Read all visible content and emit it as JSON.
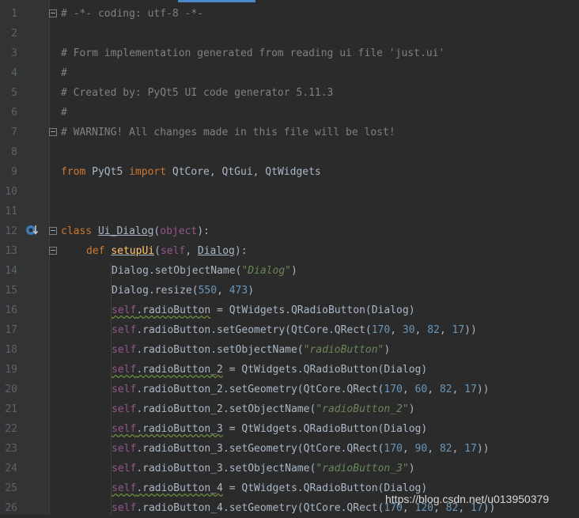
{
  "lines": [
    {
      "n": "1"
    },
    {
      "n": "2"
    },
    {
      "n": "3"
    },
    {
      "n": "4"
    },
    {
      "n": "5"
    },
    {
      "n": "6"
    },
    {
      "n": "7"
    },
    {
      "n": "8"
    },
    {
      "n": "9"
    },
    {
      "n": "10"
    },
    {
      "n": "11"
    },
    {
      "n": "12"
    },
    {
      "n": "13"
    },
    {
      "n": "14"
    },
    {
      "n": "15"
    },
    {
      "n": "16"
    },
    {
      "n": "17"
    },
    {
      "n": "18"
    },
    {
      "n": "19"
    },
    {
      "n": "20"
    },
    {
      "n": "21"
    },
    {
      "n": "22"
    },
    {
      "n": "23"
    },
    {
      "n": "24"
    },
    {
      "n": "25"
    },
    {
      "n": "26"
    }
  ],
  "code": {
    "l1": "# -*- coding: utf-8 -*-",
    "l3": "# Form implementation generated from reading ui file 'just.ui'",
    "l4": "#",
    "l5": "# Created by: PyQt5 UI code generator 5.11.3",
    "l6": "#",
    "l7": "# WARNING! All changes made in this file will be lost!",
    "kw_from": "from",
    "mod_pyqt5": " PyQt5 ",
    "kw_import": "import",
    "imports": " QtCore, QtGui, QtWidgets",
    "kw_class": "class",
    "cls_name": "Ui_Dialog",
    "kw_object": "object",
    "kw_def": "def",
    "fn_setupui": "setupUi",
    "kw_self": "self",
    "arg_dialog": "Dialog",
    "dialog": "Dialog",
    "set_object_name": ".setObjectName(",
    "str_dialog": "\"Dialog\"",
    "resize": ".resize(",
    "num_550": "550",
    "num_473": "473",
    "rb1_attr": ".radioButton",
    "rb2_attr": ".radioButton_2",
    "rb3_attr": ".radioButton_3",
    "rb4_attr": ".radioButton_4",
    "rb1_create": " = QtWidgets.QRadioButton(Dialog)",
    "set_geometry": ".setGeometry(QtCore.QRect(",
    "set_obj": ".setObjectName(",
    "str_rb1": "\"radioButton\"",
    "str_rb2": "\"radioButton_2\"",
    "str_rb3": "\"radioButton_3\"",
    "geo_170": "170",
    "geo_30": "30",
    "geo_60": "60",
    "geo_90": "90",
    "geo_120": "120",
    "geo_82": "82",
    "geo_17": "17"
  },
  "watermark": "https://blog.csdn.net/u013950379",
  "colors": {
    "background": "#2b2b2b",
    "gutter": "#313335",
    "keyword": "#cc7832",
    "string": "#6a8759",
    "number": "#6897bb",
    "comment": "#808080",
    "self": "#94558d",
    "function": "#ffc66d",
    "text": "#a9b7c6"
  }
}
